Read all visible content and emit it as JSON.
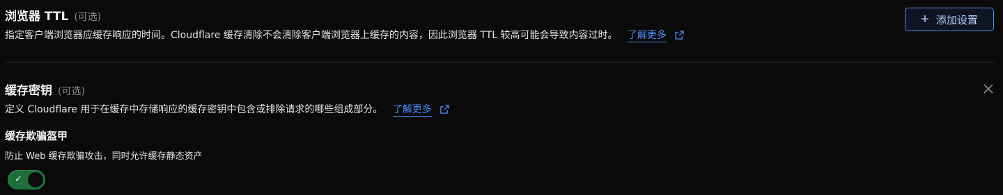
{
  "browser_ttl": {
    "title": "浏览器 TTL",
    "optional": "(可选)",
    "description": "指定客户端浏览器应缓存响应的时间。Cloudflare 缓存清除不会清除客户端浏览器上缓存的内容，因此浏览器 TTL 较高可能会导致内容过时。",
    "learn_more": "了解更多",
    "add_button": "添加设置"
  },
  "cache_key": {
    "title": "缓存密钥",
    "optional": "(可选)",
    "description": "定义 Cloudflare 用于在缓存中存储响应的缓存密钥中包含或排除请求的哪些组成部分。",
    "learn_more": "了解更多",
    "deception": {
      "title": "缓存欺骗盔甲",
      "description": "防止 Web 缓存欺骗攻击，同时允许缓存静态资产",
      "toggle_on": true
    }
  },
  "colors": {
    "accent": "#4a8df5",
    "toggle_on": "#1f6e3a",
    "background": "#0a0a0a"
  },
  "icons": {
    "external_link": "external-link-icon",
    "plus": "plus-icon",
    "close": "close-icon",
    "check": "check-icon"
  }
}
